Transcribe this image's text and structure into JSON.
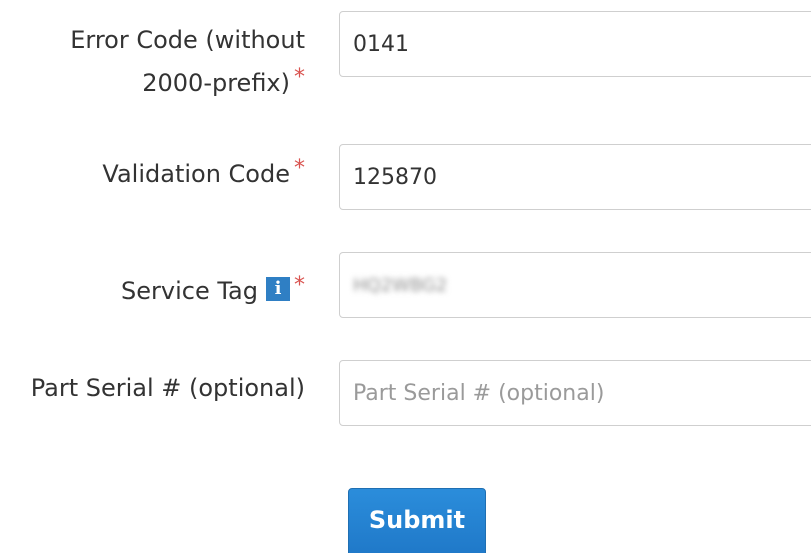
{
  "form": {
    "error_code": {
      "label_line1": "Error Code (without",
      "label_line2": "2000-prefix)",
      "required_mark": "*",
      "value": "0141"
    },
    "validation_code": {
      "label": "Validation Code",
      "required_mark": "*",
      "value": "125870"
    },
    "service_tag": {
      "label": "Service Tag",
      "info_icon_glyph": "i",
      "info_icon": "info-icon",
      "required_mark": "*",
      "value": "HQ2WBG2"
    },
    "part_serial": {
      "label": "Part Serial # (optional)",
      "value": "",
      "placeholder": "Part Serial # (optional)"
    },
    "submit_label": "Submit"
  },
  "colors": {
    "required": "#d9534f",
    "info_icon_bg": "#2f7fc4",
    "button_bg": "#1f78c8",
    "label_text": "#333333",
    "placeholder_text": "#9a9a9a",
    "field_border": "#cfcfcf"
  }
}
